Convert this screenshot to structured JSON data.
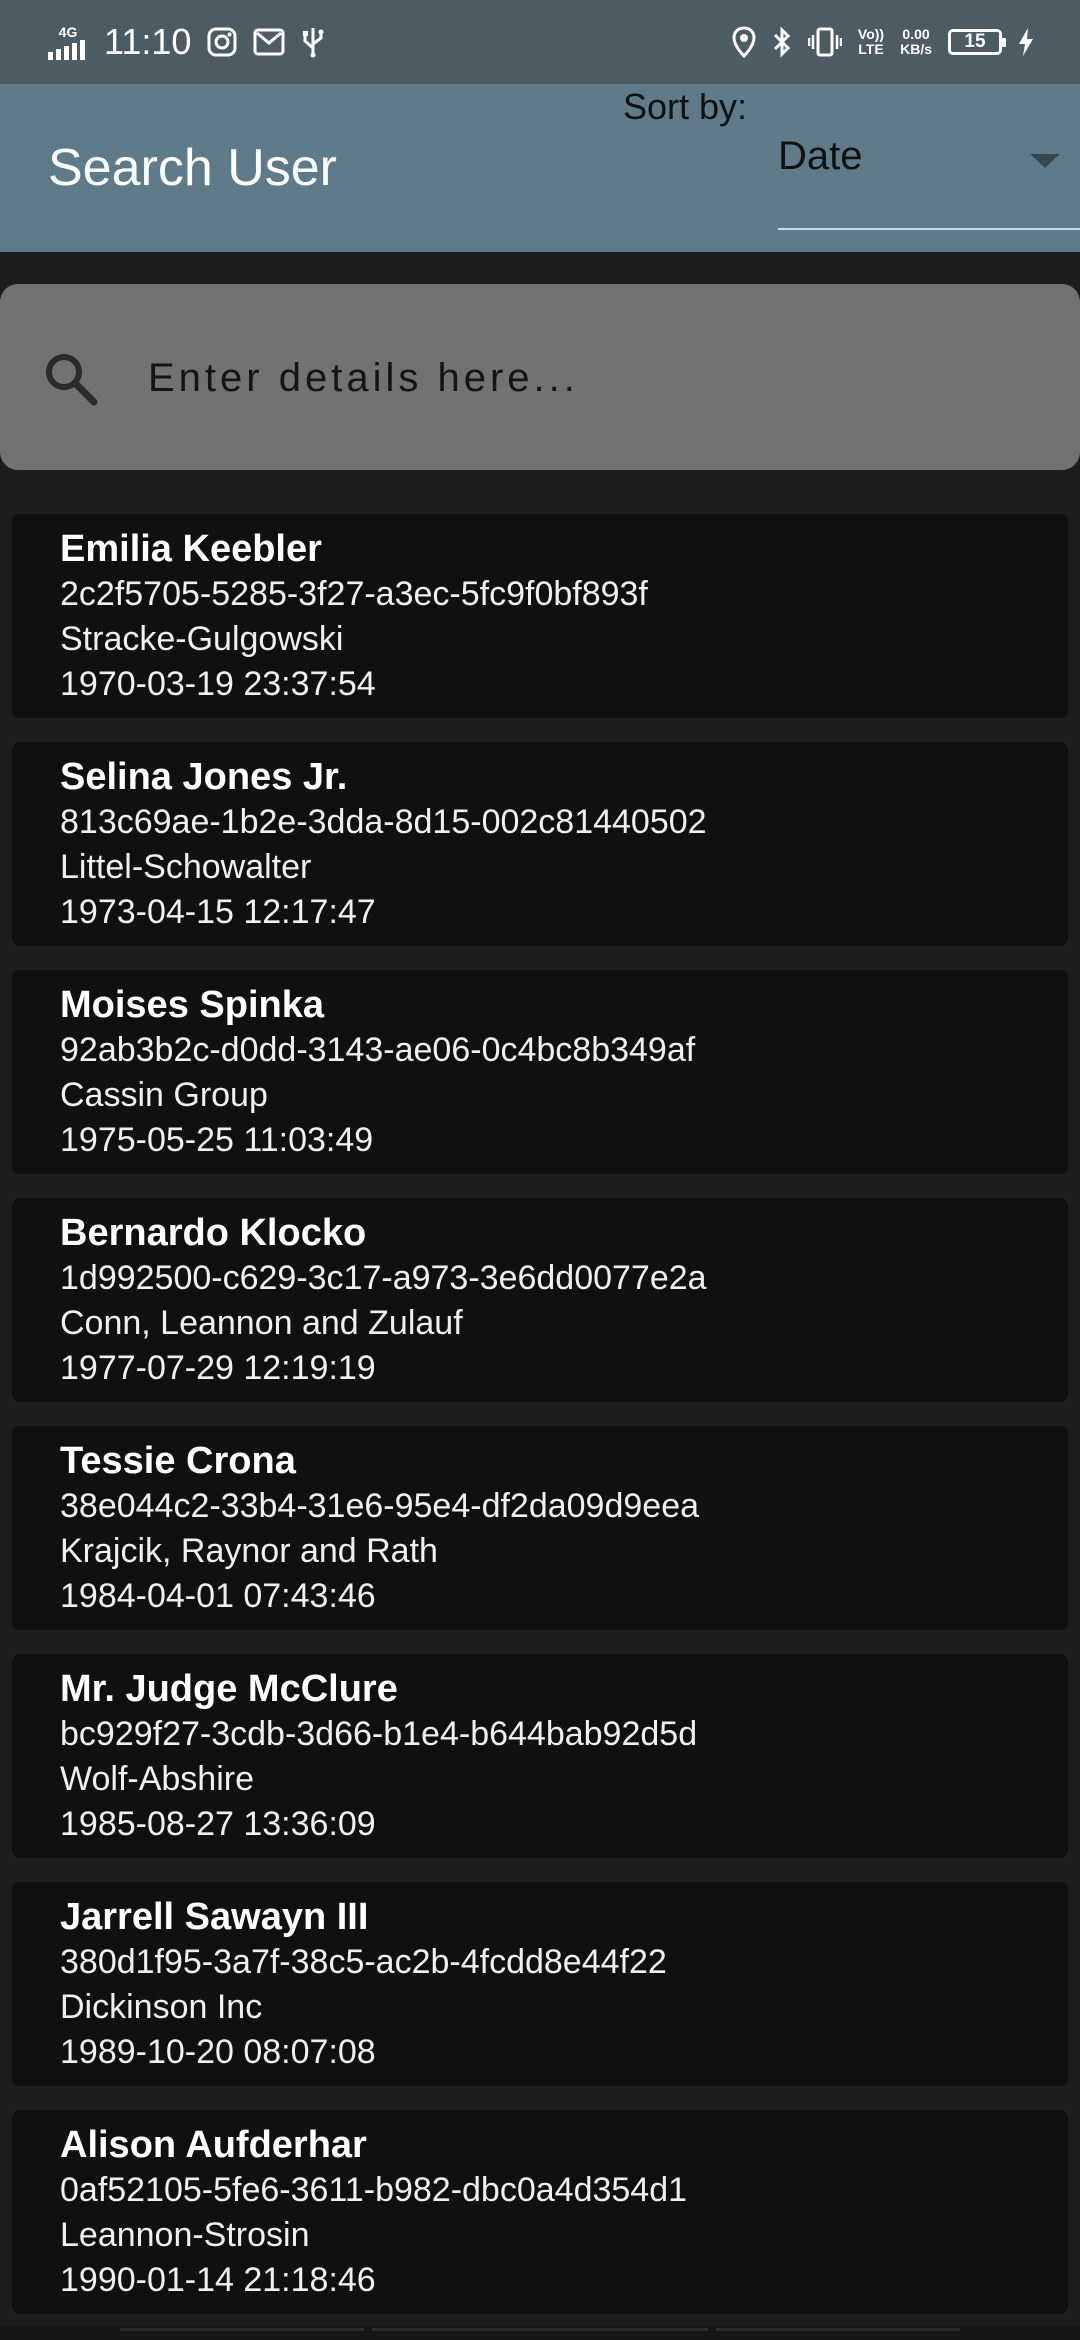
{
  "status_bar": {
    "network": "4G",
    "time": "11:10",
    "volte": [
      "Vo))",
      "LTE"
    ],
    "speed": [
      "0.00",
      "KB/s"
    ],
    "battery": "15"
  },
  "app_bar": {
    "title": "Search User",
    "sort_label": "Sort by:",
    "sort_value": "Date"
  },
  "search": {
    "placeholder": "Enter details here..."
  },
  "users": [
    {
      "name": "Emilia Keebler",
      "id": "2c2f5705-5285-3f27-a3ec-5fc9f0bf893f",
      "company": "Stracke-Gulgowski",
      "date": "1970-03-19 23:37:54"
    },
    {
      "name": "Selina Jones Jr.",
      "id": "813c69ae-1b2e-3dda-8d15-002c81440502",
      "company": "Littel-Schowalter",
      "date": "1973-04-15 12:17:47"
    },
    {
      "name": "Moises Spinka",
      "id": "92ab3b2c-d0dd-3143-ae06-0c4bc8b349af",
      "company": "Cassin Group",
      "date": "1975-05-25 11:03:49"
    },
    {
      "name": "Bernardo Klocko",
      "id": "1d992500-c629-3c17-a973-3e6dd0077e2a",
      "company": "Conn, Leannon and Zulauf",
      "date": "1977-07-29 12:19:19"
    },
    {
      "name": "Tessie Crona",
      "id": "38e044c2-33b4-31e6-95e4-df2da09d9eea",
      "company": "Krajcik, Raynor and Rath",
      "date": "1984-04-01 07:43:46"
    },
    {
      "name": "Mr. Judge McClure",
      "id": "bc929f27-3cdb-3d66-b1e4-b644bab92d5d",
      "company": "Wolf-Abshire",
      "date": "1985-08-27 13:36:09"
    },
    {
      "name": "Jarrell Sawayn III",
      "id": "380d1f95-3a7f-38c5-ac2b-4fcdd8e44f22",
      "company": "Dickinson Inc",
      "date": "1989-10-20 08:07:08"
    },
    {
      "name": "Alison Aufderhar",
      "id": "0af52105-5fe6-3611-b982-dbc0a4d354d1",
      "company": "Leannon-Strosin",
      "date": "1990-01-14 21:18:46"
    }
  ]
}
